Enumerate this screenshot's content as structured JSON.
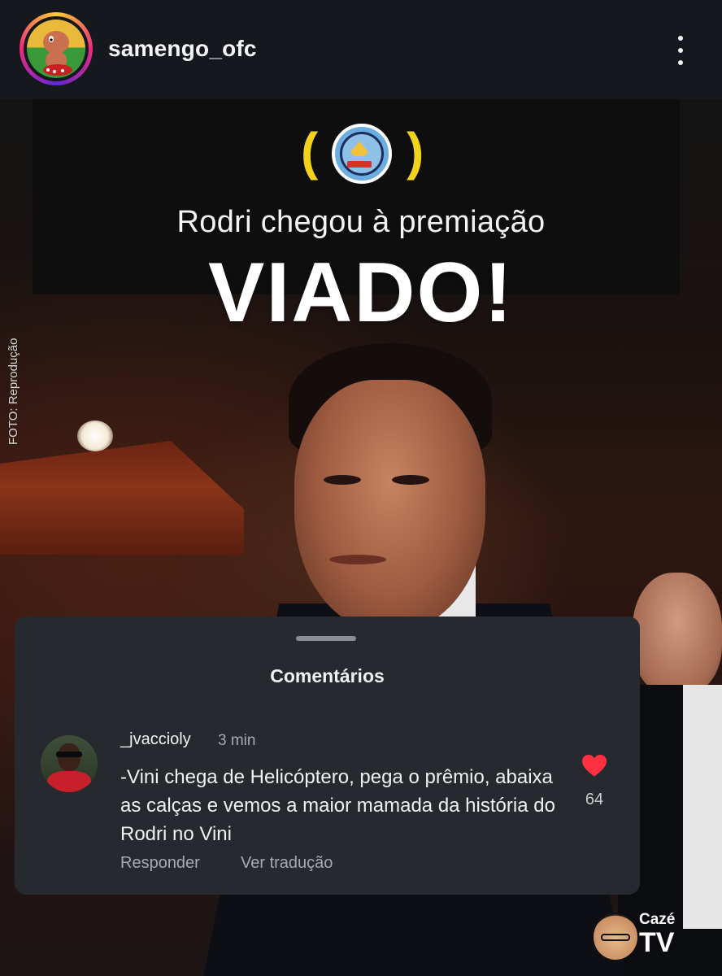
{
  "header": {
    "username": "samengo_ofc",
    "menu_icon": "more-vertical-icon",
    "avatar_icon": "profile-avatar"
  },
  "post": {
    "club_badge_icon": "manchester-city-badge",
    "paren_left": "(",
    "paren_right": ")",
    "headline": "Rodri chegou à premiação",
    "big_word": "VIADO!",
    "photo_credit": "FOTO: Reprodução",
    "accent_color": "#f2d21a"
  },
  "comments_sheet": {
    "title": "Comentários",
    "comment": {
      "username": "_jvaccioly",
      "time": "3 min",
      "text": "-Vini chega de Helicóptero, pega o prêmio, abaixa as calças e vemos a maior mamada da história do Rodri no Vini",
      "likes": "64",
      "reply_label": "Responder",
      "translate_label": "Ver tradução",
      "heart_color": "#ff3040"
    }
  },
  "watermark": {
    "line1": "Cazé",
    "line2": "TV"
  }
}
